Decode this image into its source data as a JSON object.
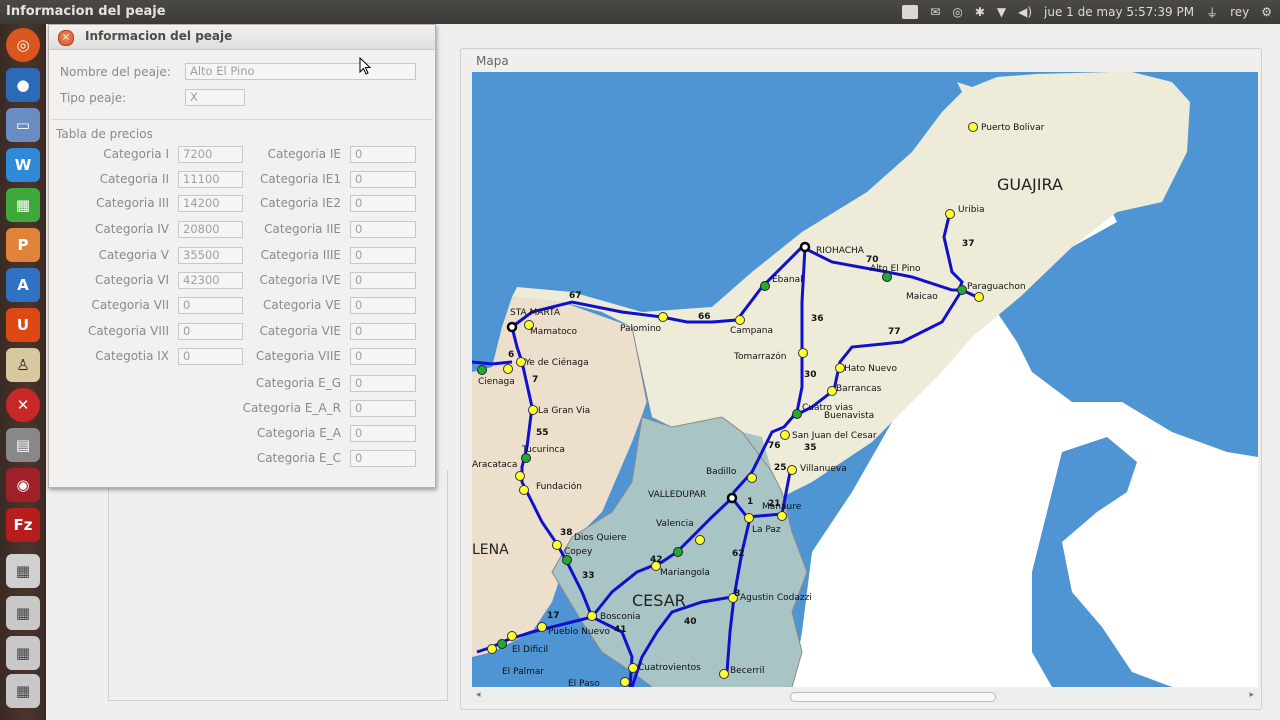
{
  "topbar": {
    "window_title": "Informacion del peaje",
    "datetime": "jue 1 de may  5:57:39 PM",
    "user": "rey"
  },
  "dialog": {
    "title": "Informacion del peaje",
    "nombre_label": "Nombre del peaje:",
    "nombre_value": "Alto El Pino",
    "tipo_label": "Tipo peaje:",
    "tipo_value": "X",
    "tabla_label": "Tabla de precios",
    "left_prices": [
      {
        "label": "Categoria I",
        "value": "7200"
      },
      {
        "label": "Categoria II",
        "value": "11100"
      },
      {
        "label": "Categoria III",
        "value": "14200"
      },
      {
        "label": "Categoria IV",
        "value": "20800"
      },
      {
        "label": "Categoria V",
        "value": "35500"
      },
      {
        "label": "Categoria VI",
        "value": "42300"
      },
      {
        "label": "Categoria VII",
        "value": "0"
      },
      {
        "label": "Categoria VIII",
        "value": "0"
      },
      {
        "label": "Categotia IX",
        "value": "0"
      }
    ],
    "right_prices": [
      {
        "label": "Categoria IE",
        "value": "0"
      },
      {
        "label": "Categoria IE1",
        "value": "0"
      },
      {
        "label": "Categoria IE2",
        "value": "0"
      },
      {
        "label": "Categoria IIE",
        "value": "0"
      },
      {
        "label": "Categoria IIIE",
        "value": "0"
      },
      {
        "label": "Categoria IVE",
        "value": "0"
      },
      {
        "label": "Categoria VE",
        "value": "0"
      },
      {
        "label": "Categoria VIE",
        "value": "0"
      },
      {
        "label": "Categoria VIIE",
        "value": "0"
      },
      {
        "label": "Categoria E_G",
        "value": "0"
      },
      {
        "label": "Categoria E_A_R",
        "value": "0"
      },
      {
        "label": "Categoria E_A",
        "value": "0"
      },
      {
        "label": "Categoria E_C",
        "value": "0"
      }
    ]
  },
  "map": {
    "panel_label": "Mapa",
    "regions": {
      "guajira": "GUAJIRA",
      "cesar": "CESAR",
      "magdalena_partial": "LENA"
    },
    "places": {
      "puerto_bolivar": "Puerto Bolivar",
      "uribia": "Uribia",
      "riohacha": "RIOHACHA",
      "alto_el_pino": "Alto El Pino",
      "maicao": "Maicao",
      "paraguachon": "Paraguachon",
      "ebanal": "Ebanal",
      "santa_marta": "STA MARTA",
      "mamatoco": "Mamatoco",
      "palomino": "Palomino",
      "campana": "Campana",
      "tomarrazon": "Tomarrazón",
      "cuatro_vias": "Cuatro vias",
      "hato_nuevo": "Hato Nuevo",
      "barrancas": "Barrancas",
      "buenavista": "Buenavista",
      "san_juan": "San Juan del Cesar",
      "villanueva": "Villanueva",
      "badillo": "Badillo",
      "valledupar": "VALLEDUPAR",
      "manaure": "Manaure",
      "la_paz": "La Paz",
      "cienaga": "Cienaga",
      "tasajera": "Ye de Ciénaga",
      "gran_via": "La Gran Via",
      "tucurinca": "Tucurinca",
      "aracataca": "Aracataca",
      "fundacion": "Fundación",
      "dios_quiere": "Dios Quiere",
      "copey": "Copey",
      "valencia": "Valencia",
      "mariangola": "Mariangola",
      "agustin": "Agustin Codazzi",
      "bosconia": "Bosconia",
      "pueblo_nuevo": "Pueblo Nuevo",
      "el_dificil": "El Dificil",
      "el_palmar": "El Palmar",
      "cuatrovientos": "Cuatrovientos",
      "becerril": "Becerril",
      "el_paso": "El Paso"
    },
    "route_numbers": [
      "67",
      "66",
      "70",
      "36",
      "37",
      "77",
      "30",
      "35",
      "25",
      "21",
      "1",
      "62",
      "42",
      "33",
      "41",
      "38",
      "7",
      "55",
      "6",
      "17",
      "40",
      "8",
      "76"
    ]
  }
}
